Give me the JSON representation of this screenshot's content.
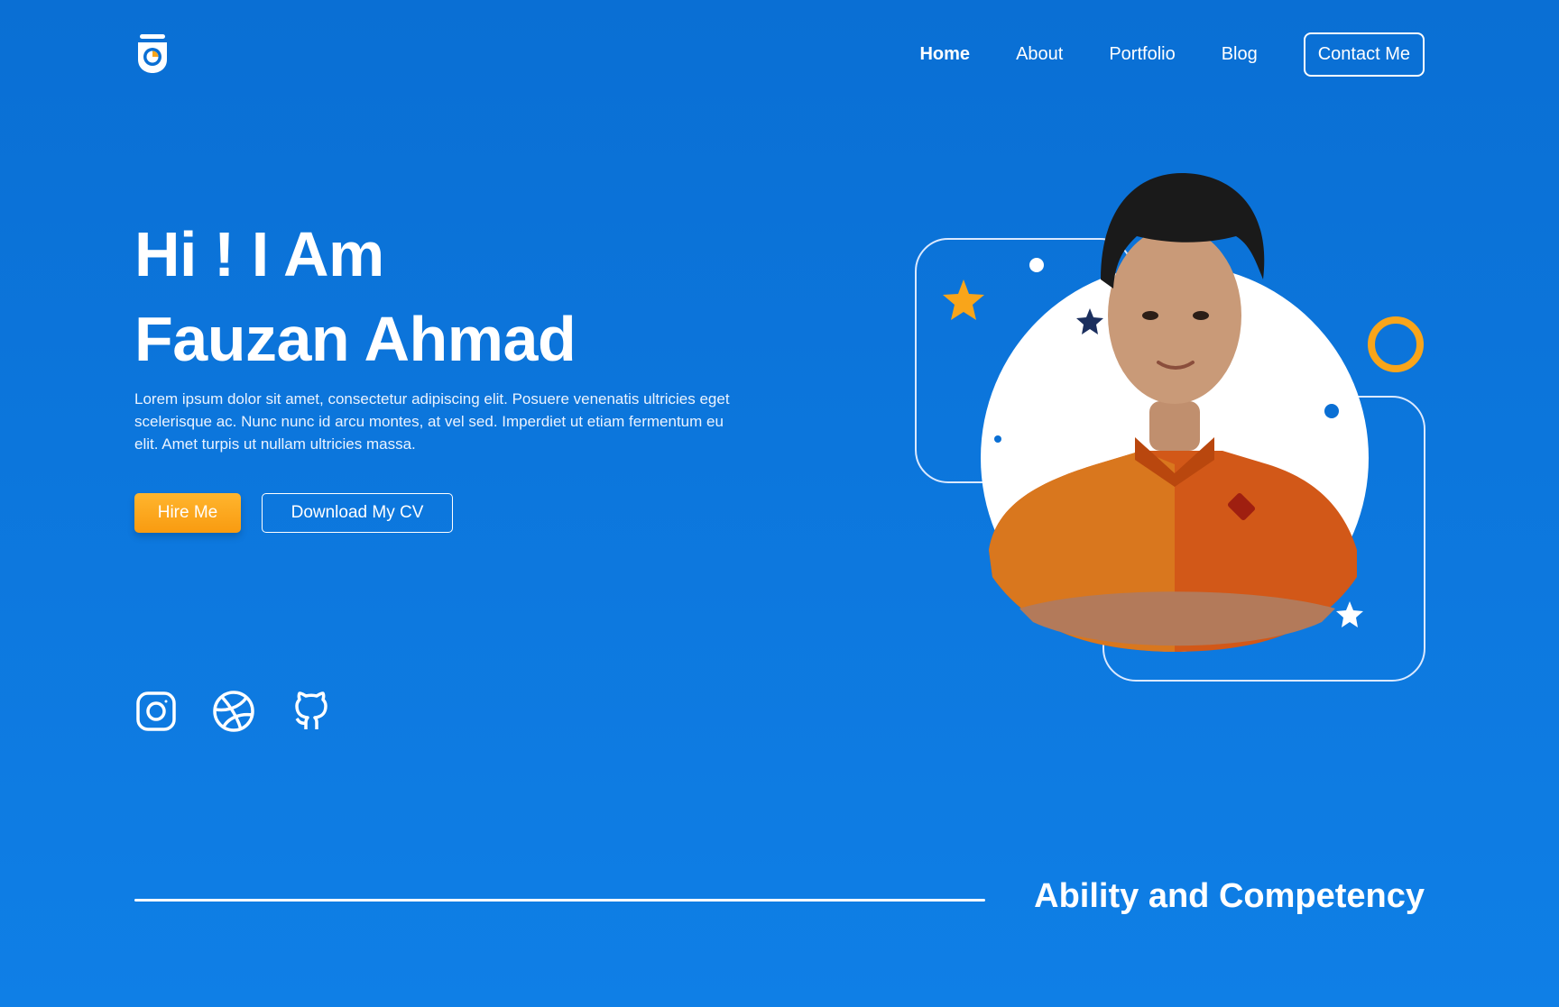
{
  "nav": {
    "logo_icon": "app-logo-icon",
    "items": [
      {
        "label": "Home",
        "active": true
      },
      {
        "label": "About",
        "active": false
      },
      {
        "label": "Portfolio",
        "active": false
      },
      {
        "label": "Blog",
        "active": false
      }
    ],
    "contact_label": "Contact Me"
  },
  "hero": {
    "greeting": "Hi ! I Am",
    "name": "Fauzan Ahmad",
    "description": "Lorem ipsum dolor sit amet, consectetur adipiscing elit. Posuere venenatis ultricies eget scelerisque ac. Nunc nunc id arcu montes, at vel sed. Imperdiet ut etiam fermentum eu elit. Amet turpis ut nullam ultricies massa.",
    "hire_label": "Hire Me",
    "cv_label": "Download My CV"
  },
  "social": [
    {
      "icon": "instagram-icon"
    },
    {
      "icon": "dribbble-icon"
    },
    {
      "icon": "github-icon"
    }
  ],
  "section": {
    "title": "Ability and Competency"
  },
  "colors": {
    "background_top": "#0a6fd4",
    "background_bottom": "#0f7fe6",
    "accent": "#f9a51a",
    "star_dark": "#1b2f5e"
  }
}
